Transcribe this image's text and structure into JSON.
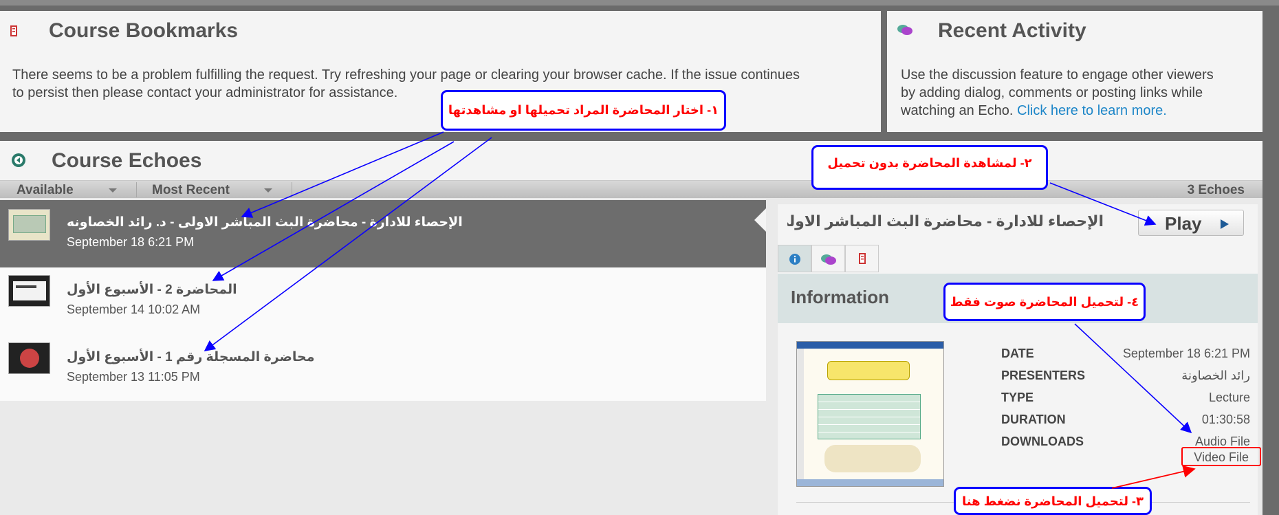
{
  "bookmarks": {
    "title": "Course Bookmarks",
    "message_line1": "There seems to be a problem fulfilling the request. Try refreshing your page or clearing your browser cache. If the issue continues",
    "message_line2": "to persist then please contact your administrator for assistance."
  },
  "activity": {
    "title": "Recent Activity",
    "text_line1": "Use the discussion feature to engage other viewers",
    "text_line2": "by adding dialog, comments or posting links while",
    "text_line3": "watching an Echo.",
    "link": "Click here to learn more."
  },
  "echoes": {
    "title": "Course Echoes",
    "filter_available": "Available",
    "filter_sort": "Most Recent",
    "count": "3 Echoes",
    "items": [
      {
        "title": "الإحصاء للادارة - محاضرة البث المباشر الاولى - د. رائد الخصاونه",
        "date": "September 18 6:21 PM"
      },
      {
        "title": "المحاضرة 2 - الأسبوع الأول",
        "date": "September 14 10:02 AM"
      },
      {
        "title": "محاضرة المسجلة رقم 1 - الأسبوع الأول",
        "date": "September 13 11:05 PM"
      }
    ]
  },
  "detail": {
    "title": "الإحصاء للادارة - محاضرة البث المباشر الاولى - ...",
    "play_label": "Play",
    "info_heading": "Information",
    "rows": [
      {
        "label": "DATE",
        "value": "September 18 6:21 PM"
      },
      {
        "label": "PRESENTERS",
        "value": "رائد الخصاونة"
      },
      {
        "label": "TYPE",
        "value": "Lecture"
      },
      {
        "label": "DURATION",
        "value": "01:30:58"
      },
      {
        "label": "DOWNLOADS",
        "value": ""
      }
    ],
    "audio_link": "Audio File",
    "video_link": "Video File"
  },
  "annotations": {
    "a1": "١- اختار المحاضرة المراد تحميلها او مشاهدتها",
    "a2": "٢- لمشاهدة المحاضرة بدون تحميل",
    "a3": "٣- لتحميل المحاضرة نضغط هنا",
    "a4": "٤- لتحميل المحاضرة صوت فقط"
  },
  "colors": {
    "annotation_border": "#0a00ff",
    "annotation_text": "#ff0000",
    "link": "#1d86c8",
    "selected_row": "#6d6d6d"
  }
}
